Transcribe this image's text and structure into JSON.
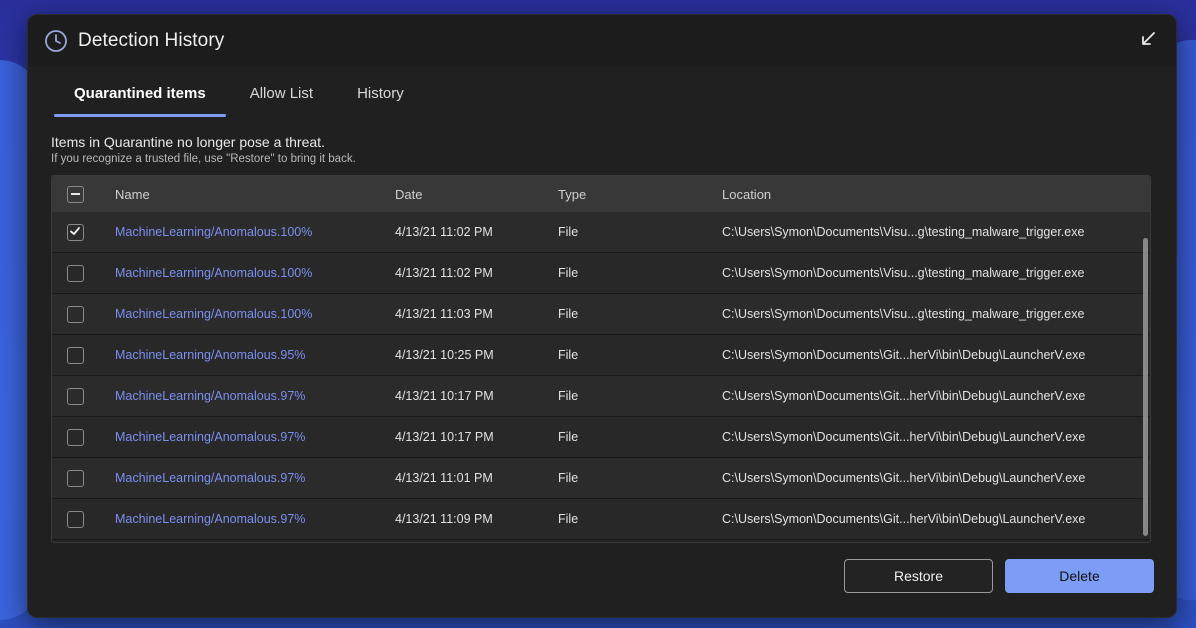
{
  "window": {
    "title": "Detection History",
    "icon": "history-clock-icon",
    "expand_icon": "collapse-arrow-icon"
  },
  "tabs": [
    {
      "label": "Quarantined items",
      "active": true
    },
    {
      "label": "Allow List",
      "active": false
    },
    {
      "label": "History",
      "active": false
    }
  ],
  "info": {
    "line1": "Items in Quarantine no longer pose a threat.",
    "line2": "If you recognize a trusted file, use \"Restore\" to bring it back."
  },
  "table": {
    "columns": {
      "name": "Name",
      "date": "Date",
      "type": "Type",
      "location": "Location"
    },
    "select_all_state": "indeterminate",
    "rows": [
      {
        "checked": true,
        "name": "MachineLearning/Anomalous.100%",
        "date": "4/13/21 11:02 PM",
        "type": "File",
        "location": "C:\\Users\\Symon\\Documents\\Visu...g\\testing_malware_trigger.exe"
      },
      {
        "checked": false,
        "name": "MachineLearning/Anomalous.100%",
        "date": "4/13/21 11:02 PM",
        "type": "File",
        "location": "C:\\Users\\Symon\\Documents\\Visu...g\\testing_malware_trigger.exe"
      },
      {
        "checked": false,
        "name": "MachineLearning/Anomalous.100%",
        "date": "4/13/21 11:03 PM",
        "type": "File",
        "location": "C:\\Users\\Symon\\Documents\\Visu...g\\testing_malware_trigger.exe"
      },
      {
        "checked": false,
        "name": "MachineLearning/Anomalous.95%",
        "date": "4/13/21 10:25 PM",
        "type": "File",
        "location": "C:\\Users\\Symon\\Documents\\Git...herVi\\bin\\Debug\\LauncherV.exe"
      },
      {
        "checked": false,
        "name": "MachineLearning/Anomalous.97%",
        "date": "4/13/21 10:17 PM",
        "type": "File",
        "location": "C:\\Users\\Symon\\Documents\\Git...herVi\\bin\\Debug\\LauncherV.exe"
      },
      {
        "checked": false,
        "name": "MachineLearning/Anomalous.97%",
        "date": "4/13/21 10:17 PM",
        "type": "File",
        "location": "C:\\Users\\Symon\\Documents\\Git...herVi\\bin\\Debug\\LauncherV.exe"
      },
      {
        "checked": false,
        "name": "MachineLearning/Anomalous.97%",
        "date": "4/13/21 11:01 PM",
        "type": "File",
        "location": "C:\\Users\\Symon\\Documents\\Git...herVi\\bin\\Debug\\LauncherV.exe"
      },
      {
        "checked": false,
        "name": "MachineLearning/Anomalous.97%",
        "date": "4/13/21 11:09 PM",
        "type": "File",
        "location": "C:\\Users\\Symon\\Documents\\Git...herVi\\bin\\Debug\\LauncherV.exe"
      }
    ]
  },
  "buttons": {
    "restore": "Restore",
    "delete": "Delete"
  },
  "colors": {
    "accent": "#7d9cf5",
    "link": "#7b8ff0",
    "window_bg": "#202020"
  }
}
